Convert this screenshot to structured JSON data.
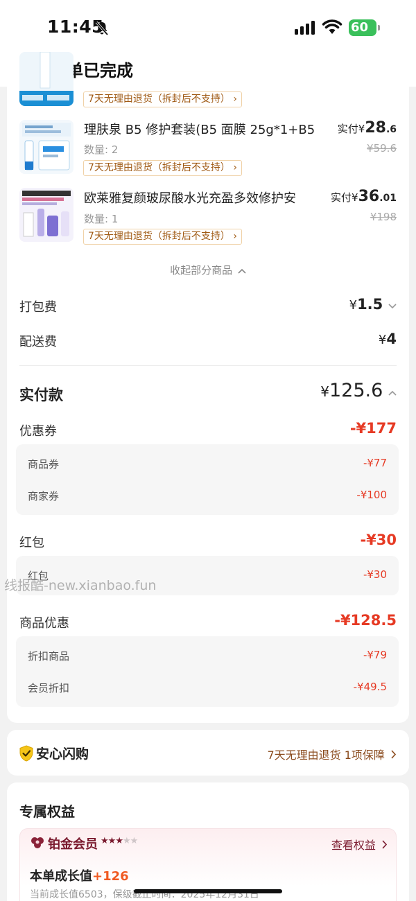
{
  "status": {
    "time": "11:45",
    "battery": "60"
  },
  "header": {
    "title": "订单已完成"
  },
  "products": [
    {
      "name": "",
      "qty": "",
      "tag": "7天无理由退货（拆封后不支持）"
    },
    {
      "name": "理肤泉 B5 修护套装(B5 面膜 25g*1+B5",
      "qty": "数量: 2",
      "tag": "7天无理由退货（拆封后不支持）",
      "paid_prefix": "实付",
      "currency": "¥",
      "paid_int": "28",
      "paid_dec": ".6",
      "orig": "¥59.6"
    },
    {
      "name": "欧莱雅复颜玻尿酸水光充盈多效修护安",
      "qty": "数量: 1",
      "tag": "7天无理由退货（拆封后不支持）",
      "paid_prefix": "实付",
      "currency": "¥",
      "paid_int": "36",
      "paid_dec": ".01",
      "orig": "¥198"
    }
  ],
  "collapse": {
    "label": "收起部分商品"
  },
  "fees": {
    "packing": {
      "label": "打包费",
      "value": "1.5"
    },
    "delivery": {
      "label": "配送费",
      "value": "4"
    }
  },
  "total": {
    "label": "实付款",
    "currency": "¥",
    "value": "125.6"
  },
  "coupon": {
    "label": "优惠券",
    "value": "-¥177",
    "items": [
      {
        "label": "商品券",
        "value": "-¥77"
      },
      {
        "label": "商家券",
        "value": "-¥100"
      }
    ]
  },
  "redpacket": {
    "label": "红包",
    "value": "-¥30",
    "items": [
      {
        "label": "红包",
        "value": "-¥30"
      }
    ]
  },
  "discount": {
    "label": "商品优惠",
    "value": "-¥128.5",
    "items": [
      {
        "label": "折扣商品",
        "value": "-¥79"
      },
      {
        "label": "会员折扣",
        "value": "-¥49.5"
      }
    ]
  },
  "watermark": "线报酷-new.xianbao.fun",
  "assurance": {
    "title": "安心闪购",
    "right": "7天无理由退货 1项保障"
  },
  "rights": {
    "title": "专属权益",
    "member_name": "铂金会员",
    "member_stars": 3,
    "member_stars_total": 5,
    "member_link": "查看权益",
    "growth_label": "本单成长值",
    "growth_value": "+126",
    "growth_note": "当前成长值6503，保级截止时间：2025年12月31日"
  },
  "colors": {
    "accent_red": "#e63a24",
    "tag_brown": "#a05a14",
    "member": "#7a1a2e",
    "battery": "#3ac05b"
  }
}
